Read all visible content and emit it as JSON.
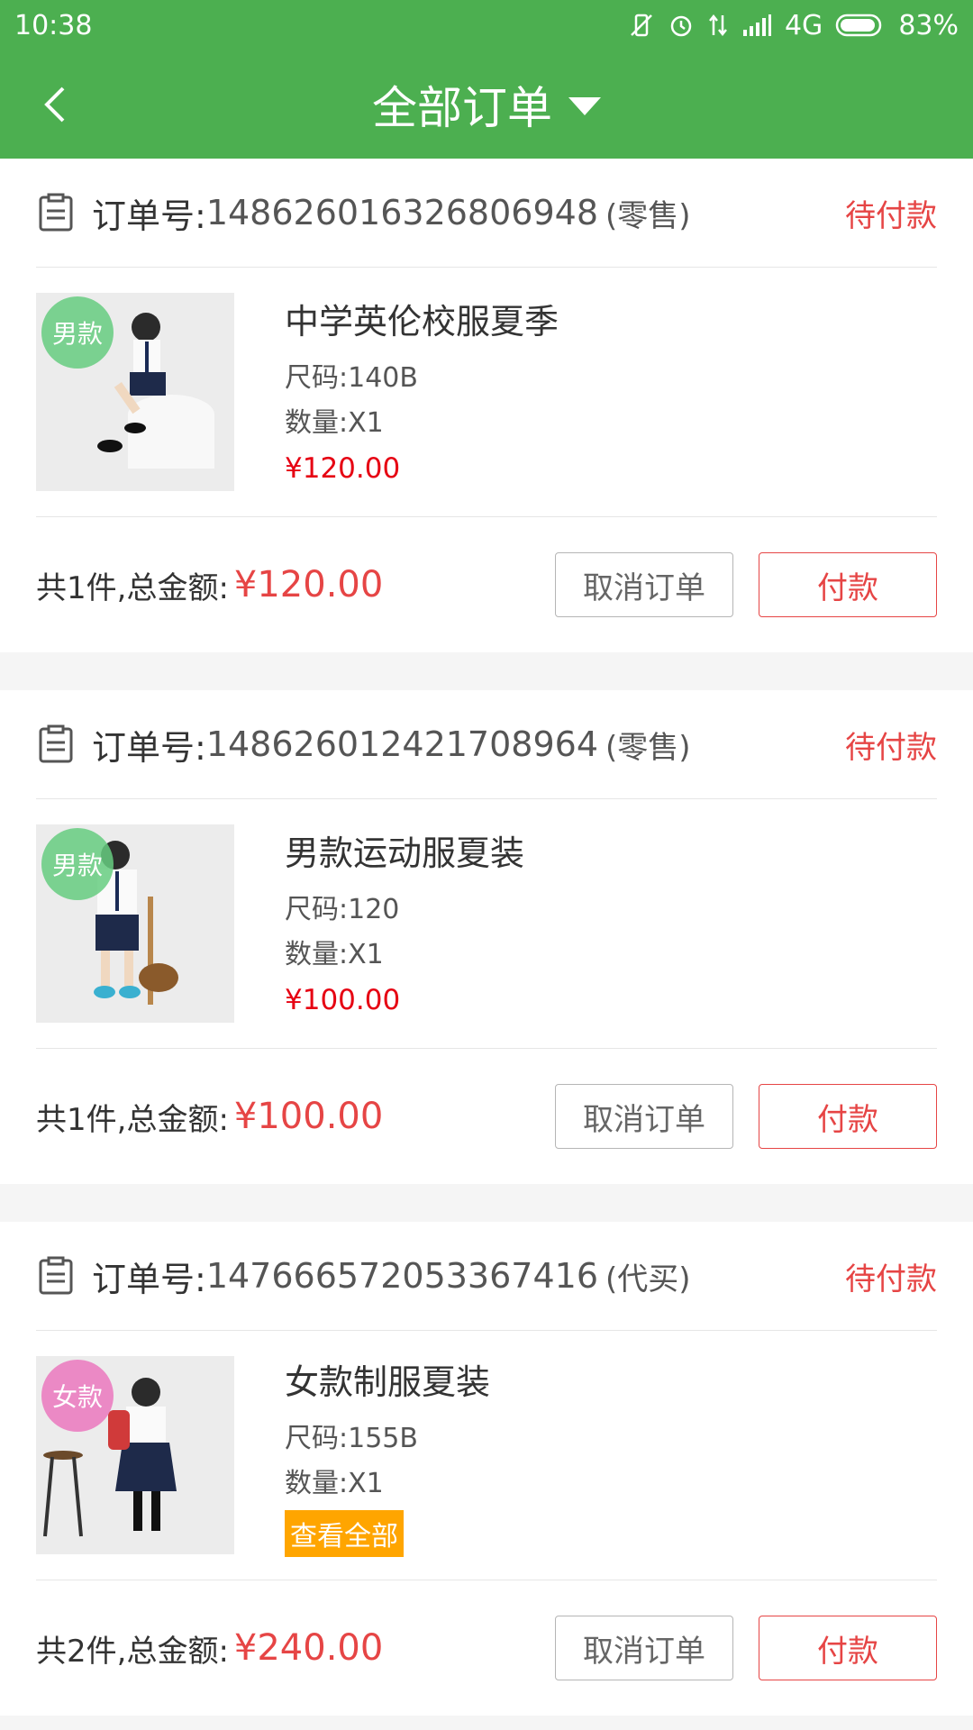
{
  "status_bar": {
    "time": "10:38",
    "network": "4G",
    "battery": "83%"
  },
  "nav": {
    "title": "全部订单"
  },
  "orders": [
    {
      "order_label": "订单号:",
      "order_no": "148626016326806948",
      "order_type": "(零售)",
      "status": "待付款",
      "item": {
        "badge": "男款",
        "name": "中学英伦校服夏季",
        "size": "尺码:140B",
        "qty": "数量:X1",
        "price": "¥120.00"
      },
      "total_label": "共1件,总金额:",
      "total": "¥120.00",
      "cancel_label": "取消订单",
      "pay_label": "付款"
    },
    {
      "order_label": "订单号:",
      "order_no": "148626012421708964",
      "order_type": "(零售)",
      "status": "待付款",
      "item": {
        "badge": "男款",
        "name": "男款运动服夏装",
        "size": "尺码:120",
        "qty": "数量:X1",
        "price": "¥100.00"
      },
      "total_label": "共1件,总金额:",
      "total": "¥100.00",
      "cancel_label": "取消订单",
      "pay_label": "付款"
    },
    {
      "order_label": "订单号:",
      "order_no": "147666572053367416",
      "order_type": "(代买)",
      "status": "待付款",
      "item": {
        "badge": "女款",
        "name": "女款制服夏装",
        "size": "尺码:155B",
        "qty": "数量:X1",
        "view_all": "查看全部"
      },
      "total_label": "共2件,总金额:",
      "total": "¥240.00",
      "cancel_label": "取消订单",
      "pay_label": "付款"
    }
  ]
}
